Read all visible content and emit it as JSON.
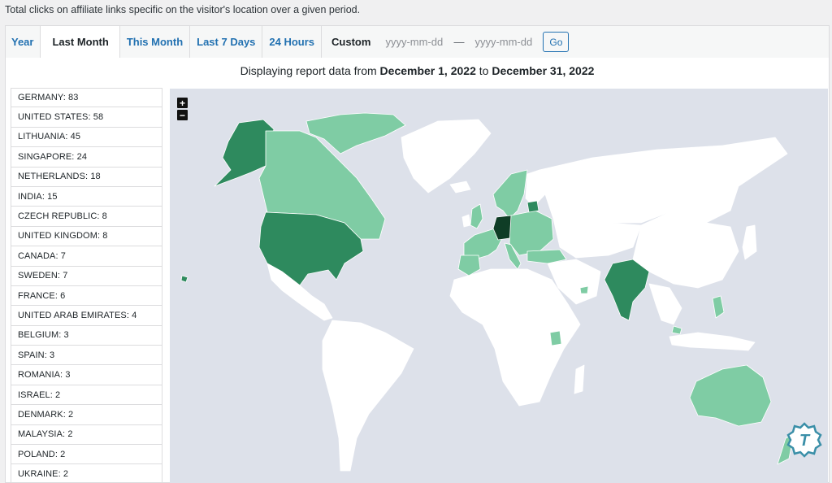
{
  "description": "Total clicks on affiliate links specific on the visitor's location over a given period.",
  "tabs": [
    "Year",
    "Last Month",
    "This Month",
    "Last 7 Days",
    "24 Hours"
  ],
  "custom": {
    "label": "Custom",
    "from_placeholder": "yyyy-mm-dd",
    "separator": "—",
    "to_placeholder": "yyyy-mm-dd",
    "go_label": "Go"
  },
  "report": {
    "prefix": "Displaying report data from",
    "start": "December 1, 2022",
    "middle": "to",
    "end": "December 31, 2022"
  },
  "countries": [
    "GERMANY: 83",
    "UNITED STATES: 58",
    "LITHUANIA: 45",
    "SINGAPORE: 24",
    "NETHERLANDS: 18",
    "INDIA: 15",
    "CZECH REPUBLIC: 8",
    "UNITED KINGDOM: 8",
    "CANADA: 7",
    "SWEDEN: 7",
    "FRANCE: 6",
    "UNITED ARAB EMIRATES: 4",
    "BELGIUM: 3",
    "SPAIN: 3",
    "ROMANIA: 3",
    "ISRAEL: 2",
    "DENMARK: 2",
    "MALAYSIA: 2",
    "POLAND: 2",
    "UKRAINE: 2"
  ],
  "map": {
    "zoom_in": "+",
    "zoom_out": "−",
    "colors": {
      "ocean": "#dde1ea",
      "none": "#ffffff",
      "low": "#7fcca4",
      "mid": "#2e8a5e",
      "high": "#1f6a48",
      "top": "#0f3d26"
    }
  }
}
